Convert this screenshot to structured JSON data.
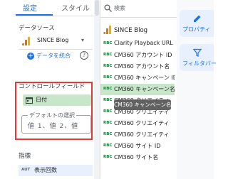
{
  "tabs": {
    "setup": "設定",
    "style": "スタイル"
  },
  "left": {
    "datasource_label": "データソース",
    "datasource_name": "SINCE Blog",
    "merge_data": "データを統合",
    "control_field_label": "コントロールフィールド",
    "date_chip": "日付",
    "default_selection_label": "デフォルトの選択",
    "default_value": "値 1、値 2、値",
    "metric_label": "指標",
    "metric_badge": "AUT",
    "metric_name": "表示回数"
  },
  "fields": {
    "search_placeholder": "検索",
    "source_title": "SINCE Blog",
    "type_badge": "RBC",
    "items": [
      "Clarity Playback URL",
      "CM360 アカウント ID",
      "CM360 アカウント名",
      "CM360 キャンペーン ID",
      "CM360 キャンペーン名",
      "CM360 クリエイティ",
      "CM360 クリエイティ",
      "CM360 クリエイティ",
      "CM360 クリエイティ",
      "CM360 サイト ID",
      "CM360 サイト名"
    ],
    "tooltip": "CM360 キャンペーン名"
  },
  "right": {
    "properties": "プロパティ",
    "filter_bar": "フィルタバー"
  },
  "colors": {
    "accent": "#1a73e8",
    "highlight_green": "#c8e6c9",
    "annotation_red": "#e53935"
  }
}
